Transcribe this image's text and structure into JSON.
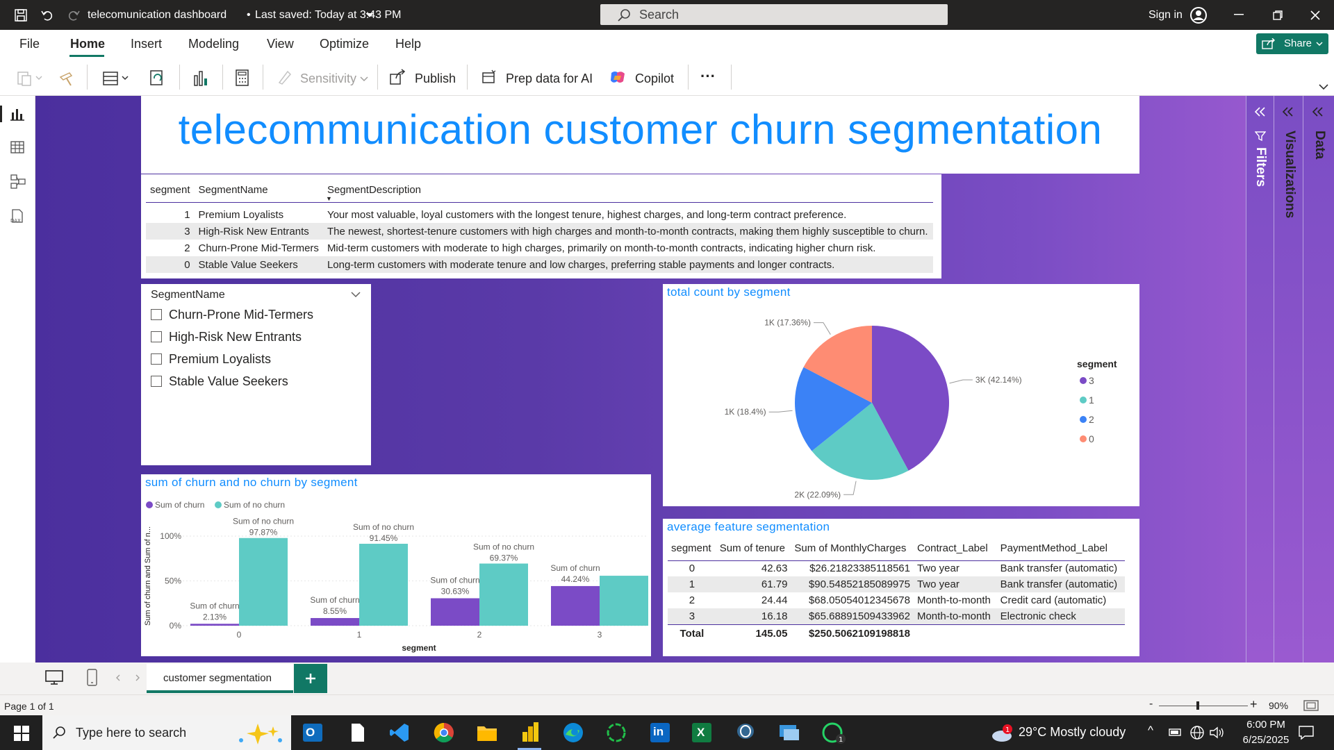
{
  "app": {
    "file_title": "telecomunication dashboard",
    "saved_status": "Last saved: Today at 3:43 PM",
    "search_placeholder": "Search",
    "sign_in": "Sign in",
    "share_label": "Share"
  },
  "menu": [
    "File",
    "Home",
    "Insert",
    "Modeling",
    "View",
    "Optimize",
    "Help"
  ],
  "ribbon": {
    "sensitivity": "Sensitivity",
    "publish": "Publish",
    "prep_data": "Prep data for AI",
    "copilot": "Copilot",
    "more": "···"
  },
  "report": {
    "title": "telecommunication customer churn segmentation",
    "segment_table": {
      "headers": [
        "segment",
        "SegmentName",
        "SegmentDescription"
      ],
      "rows": [
        [
          "1",
          "Premium Loyalists",
          "Your most valuable, loyal customers with the longest tenure, highest charges, and long-term contract preference."
        ],
        [
          "3",
          "High-Risk New Entrants",
          "The newest, shortest-tenure customers with high charges and month-to-month contracts, making them highly susceptible to churn."
        ],
        [
          "2",
          "Churn-Prone Mid-Termers",
          "Mid-term customers with moderate to high charges, primarily on month-to-month contracts, indicating higher churn risk."
        ],
        [
          "0",
          "Stable Value Seekers",
          "Long-term customers with moderate tenure and low charges, preferring stable payments and longer contracts."
        ]
      ]
    },
    "slicer": {
      "title": "SegmentName",
      "options": [
        "Churn-Prone Mid-Termers",
        "High-Risk New Entrants",
        "Premium Loyalists",
        "Stable Value Seekers"
      ]
    },
    "pie_title": "total count by segment",
    "pie_legend_title": "segment",
    "bar_title": "sum of churn and no churn by segment",
    "bar_ylabel": "Sum of churn and Sum of n...",
    "bar_xlabel": "segment",
    "avg_title": "average feature segmentation",
    "avg_table": {
      "headers": [
        "segment",
        "Sum of tenure",
        "Sum of MonthlyCharges",
        "Contract_Label",
        "PaymentMethod_Label"
      ],
      "rows": [
        [
          "0",
          "42.63",
          "$26.21823385118561",
          "Two year",
          "Bank transfer (automatic)"
        ],
        [
          "1",
          "61.79",
          "$90.54852185089975",
          "Two year",
          "Bank transfer (automatic)"
        ],
        [
          "2",
          "24.44",
          "$68.05054012345678",
          "Month-to-month",
          "Credit card (automatic)"
        ],
        [
          "3",
          "16.18",
          "$65.68891509433962",
          "Month-to-month",
          "Electronic check"
        ]
      ],
      "total": [
        "Total",
        "145.05",
        "$250.5062109198818"
      ]
    }
  },
  "right_panes": [
    "Filters",
    "Visualizations",
    "Data"
  ],
  "page_tab": "customer segmentation",
  "status": {
    "page": "Page 1 of 1",
    "zoom": "90%"
  },
  "taskbar": {
    "search_placeholder": "Type here to search",
    "weather": "29°C  Mostly cloudy",
    "time": "6:00 PM",
    "date": "6/25/2025"
  },
  "colors": {
    "seg3": "#7b4bc6",
    "seg1": "#5ecbc5",
    "seg2": "#3b82f6",
    "seg0": "#fe8c73",
    "accent": "#118dff"
  },
  "chart_data": [
    {
      "type": "pie",
      "title": "total count by segment",
      "legend_title": "segment",
      "categories": [
        "3",
        "1",
        "2",
        "0"
      ],
      "values": [
        42.14,
        22.09,
        18.4,
        17.36
      ],
      "labels": [
        "3K (42.14%)",
        "2K (22.09%)",
        "1K (18.4%)",
        "1K (17.36%)"
      ],
      "legend": "right"
    },
    {
      "type": "bar",
      "title": "sum of churn and no churn by segment",
      "categories": [
        "0",
        "1",
        "2",
        "3"
      ],
      "series": [
        {
          "name": "Sum of churn",
          "values": [
            2.13,
            8.55,
            30.63,
            44.24
          ]
        },
        {
          "name": "Sum of no churn",
          "values": [
            97.87,
            91.45,
            69.37,
            55.76
          ]
        }
      ],
      "data_labels": [
        [
          "2.13%",
          "8.55%",
          "30.63%",
          "44.24%"
        ],
        [
          "97.87%",
          "91.45%",
          "69.37%",
          ""
        ]
      ],
      "yticks": [
        "0%",
        "50%",
        "100%"
      ],
      "ylim": [
        0,
        100
      ],
      "xlabel": "segment",
      "ylabel": "Sum of churn and Sum of n...",
      "legend": "top-left"
    }
  ]
}
